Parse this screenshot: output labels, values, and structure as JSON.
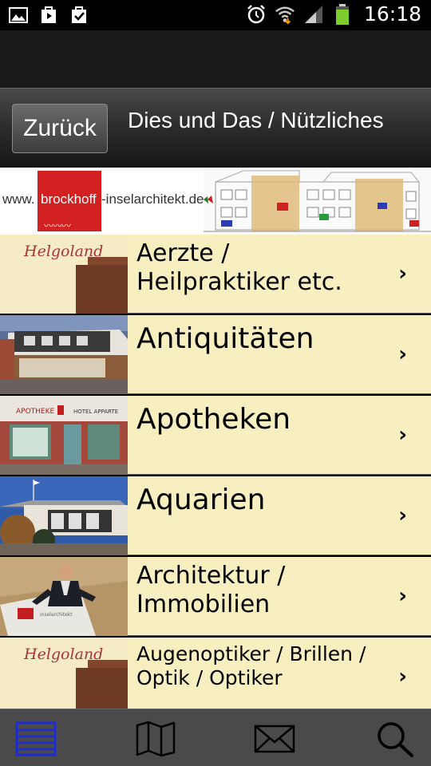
{
  "status_bar": {
    "time": "16:18",
    "left_icons": [
      "gallery-icon",
      "play-store-icon",
      "tasks-icon"
    ],
    "right_icons": [
      "alarm-icon",
      "wifi-icon",
      "signal-icon",
      "battery-icon"
    ]
  },
  "nav": {
    "back_label": "Zurück",
    "title": "Dies und Das / Nützliches"
  },
  "banner": {
    "prefix": "www.",
    "brand": "brockhoff",
    "suffix": "-inselarchitekt.de"
  },
  "list": {
    "helgoland_text": "Helgoland",
    "items": [
      {
        "label": "Aerzte / Heilpraktiker etc.",
        "thumb": "helgoland-logo"
      },
      {
        "label": "Antiquitäten",
        "thumb": "shop-photo"
      },
      {
        "label": "Apotheken",
        "thumb": "pharmacy-photo"
      },
      {
        "label": "Aquarien",
        "thumb": "aquarium-building-photo"
      },
      {
        "label": "Architektur / Immobilien",
        "thumb": "architect-photo"
      },
      {
        "label": "Augenoptiker / Brillen / Optik / Optiker",
        "thumb": "helgoland-logo"
      }
    ]
  },
  "tabbar": {
    "tabs": [
      "list-icon",
      "map-icon",
      "mail-icon",
      "search-icon"
    ],
    "active_color": "#1d2bd6",
    "icon_color": "#000000"
  }
}
